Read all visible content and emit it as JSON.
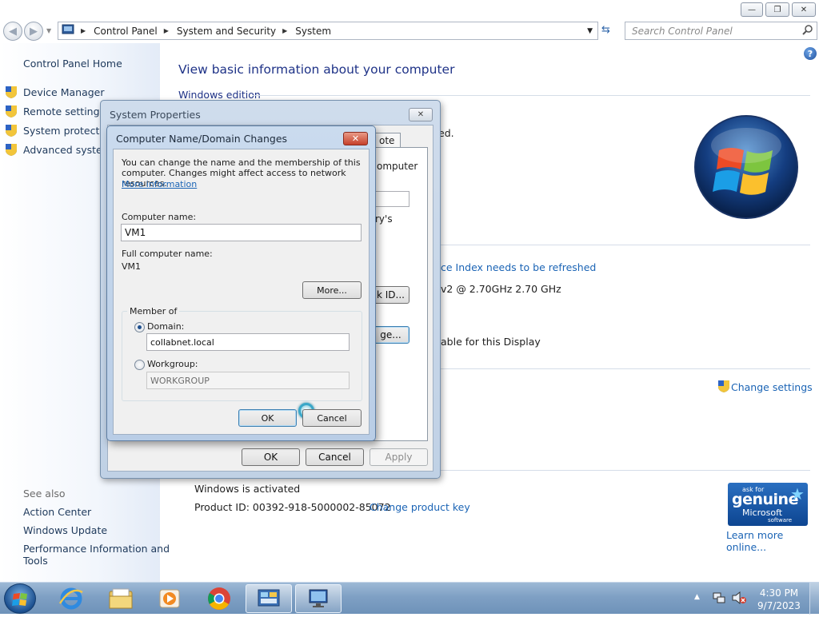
{
  "window": {
    "minimize_glyph": "—",
    "maximize_glyph": "❐",
    "close_glyph": "✕"
  },
  "address": {
    "breadcrumb": [
      "Control Panel",
      "System and Security",
      "System"
    ],
    "search_placeholder": "Search Control Panel"
  },
  "left_pane": {
    "home": "Control Panel Home",
    "tasks": [
      "Device Manager",
      "Remote settings",
      "System protection",
      "Advanced system"
    ],
    "see_also_title": "See also",
    "see_also": [
      "Action Center",
      "Windows Update",
      "Performance Information and",
      "Tools"
    ]
  },
  "main": {
    "heading": "View basic information about your computer",
    "edition_section": "Windows edition",
    "fragments": {
      "reserved": "ed.",
      "wei": "ce Index needs to be refreshed",
      "processor": "v2 @ 2.70GHz   2.70 GHz",
      "pen": "able for this Display"
    },
    "change_settings": "Change settings",
    "activation_status": "Windows is activated",
    "product_id_label": "Product ID: 00392-918-5000002-85072",
    "change_product_key": "Change product key",
    "genuine_badge": {
      "line1": "ask for",
      "line2": "genuine",
      "line3": "Microsoft",
      "line4": "software"
    },
    "learn_more": "Learn more online..."
  },
  "system_properties": {
    "title": "System Properties",
    "tab_partial": "ote",
    "fragments": {
      "computer": "omputer",
      "ys": "ry's",
      "network_id_partial": "k ID...",
      "change_partial": "ge..."
    },
    "ok": "OK",
    "cancel": "Cancel",
    "apply": "Apply"
  },
  "computer_name_dialog": {
    "title": "Computer Name/Domain Changes",
    "intro_line1": "You can change the name and the membership of this",
    "intro_line2": "computer. Changes might affect access to network resources.",
    "more_information": "More information",
    "computer_name_label": "Computer name:",
    "computer_name_value": "VM1",
    "full_name_label": "Full computer name:",
    "full_name_value": "VM1",
    "more_button": "More...",
    "member_of_label": "Member of",
    "domain_label": "Domain:",
    "domain_value": "collabnet.local",
    "workgroup_label": "Workgroup:",
    "workgroup_value": "WORKGROUP",
    "selected_membership": "domain",
    "ok": "OK",
    "cancel": "Cancel"
  },
  "taskbar": {
    "time": "4:30 PM",
    "date": "9/7/2023",
    "tray_arrow": "▲"
  }
}
